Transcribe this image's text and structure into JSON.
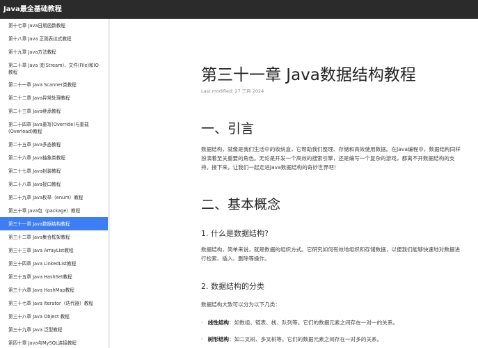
{
  "header": {
    "title": "Java最全基础教程"
  },
  "sidebar": {
    "items": [
      "第十七章 Java日期函数教程",
      "第十八章 Java 正则表达式教程",
      "第十九章 Java方法教程",
      "第二十章 Java 流(Stream)、文件(File)和IO教程",
      "第二十一章 Java Scanner类教程",
      "第二十二章 Java异常处理教程",
      "第二十三章 Java继承教程",
      "第二十四章 Java重写(Override)与重载(Overload)教程",
      "第二十五章 Java多态教程",
      "第二十六章 Java抽象类教程",
      "第二十七章 Java封装教程",
      "第二十八章 Java接口教程",
      "第二十九章 Java枚举（enum）教程",
      "第三十章 Java包（package）教程",
      "第三十一章 Java数据结构教程",
      "第三十二章 Java集合框架教程",
      "第三十三章 Java ArrayList教程",
      "第三十四章 Java LinkedList教程",
      "第三十五章 Java HashSet教程",
      "第三十六章 Java HashMap教程",
      "第三十七章 Java Iterator（迭代器）教程",
      "第三十八章 Java Object 教程",
      "第三十九章 Java 泛型教程",
      "第四十章 Java与MySQL连接教程"
    ],
    "active_index": 14
  },
  "article": {
    "title": "第三十一章 Java数据结构教程",
    "last_modified": "Last modified: 27 三月 2024",
    "h2_intro": "一、引言",
    "intro": "数据结构，就像是我们生活中的收纳盒，它帮助我们整理、存储和高效使用数据。在Java编程中，数据结构同样扮演着至关重要的角色。无论是开发一个高效的搜索引擎，还是编写一个复杂的游戏，都离不开数据结构的支持。接下来，让我们一起走进Java数据结构的奇妙世界吧！",
    "h2_basic": "二、基本概念",
    "h3_what": "1. 什么是数据结构?",
    "what": "数据结构，简单来说，就是数据的组织方式。它研究如何有效地组织和存储数据，以便我们能够快速地对数据进行检索、插入、删除等操作。",
    "h3_types": "2. 数据结构的分类",
    "types_intro": "数据结构大致可以分为以下几类：",
    "bullets": [
      {
        "term": "线性结构",
        "text": "：如数组、链表、栈、队列等。它们的数据元素之间存在一对一的关系。"
      },
      {
        "term": "树形结构",
        "text": "：如二叉树、多叉树等。它们的数据元素之间存在一对多的关系。"
      }
    ]
  }
}
